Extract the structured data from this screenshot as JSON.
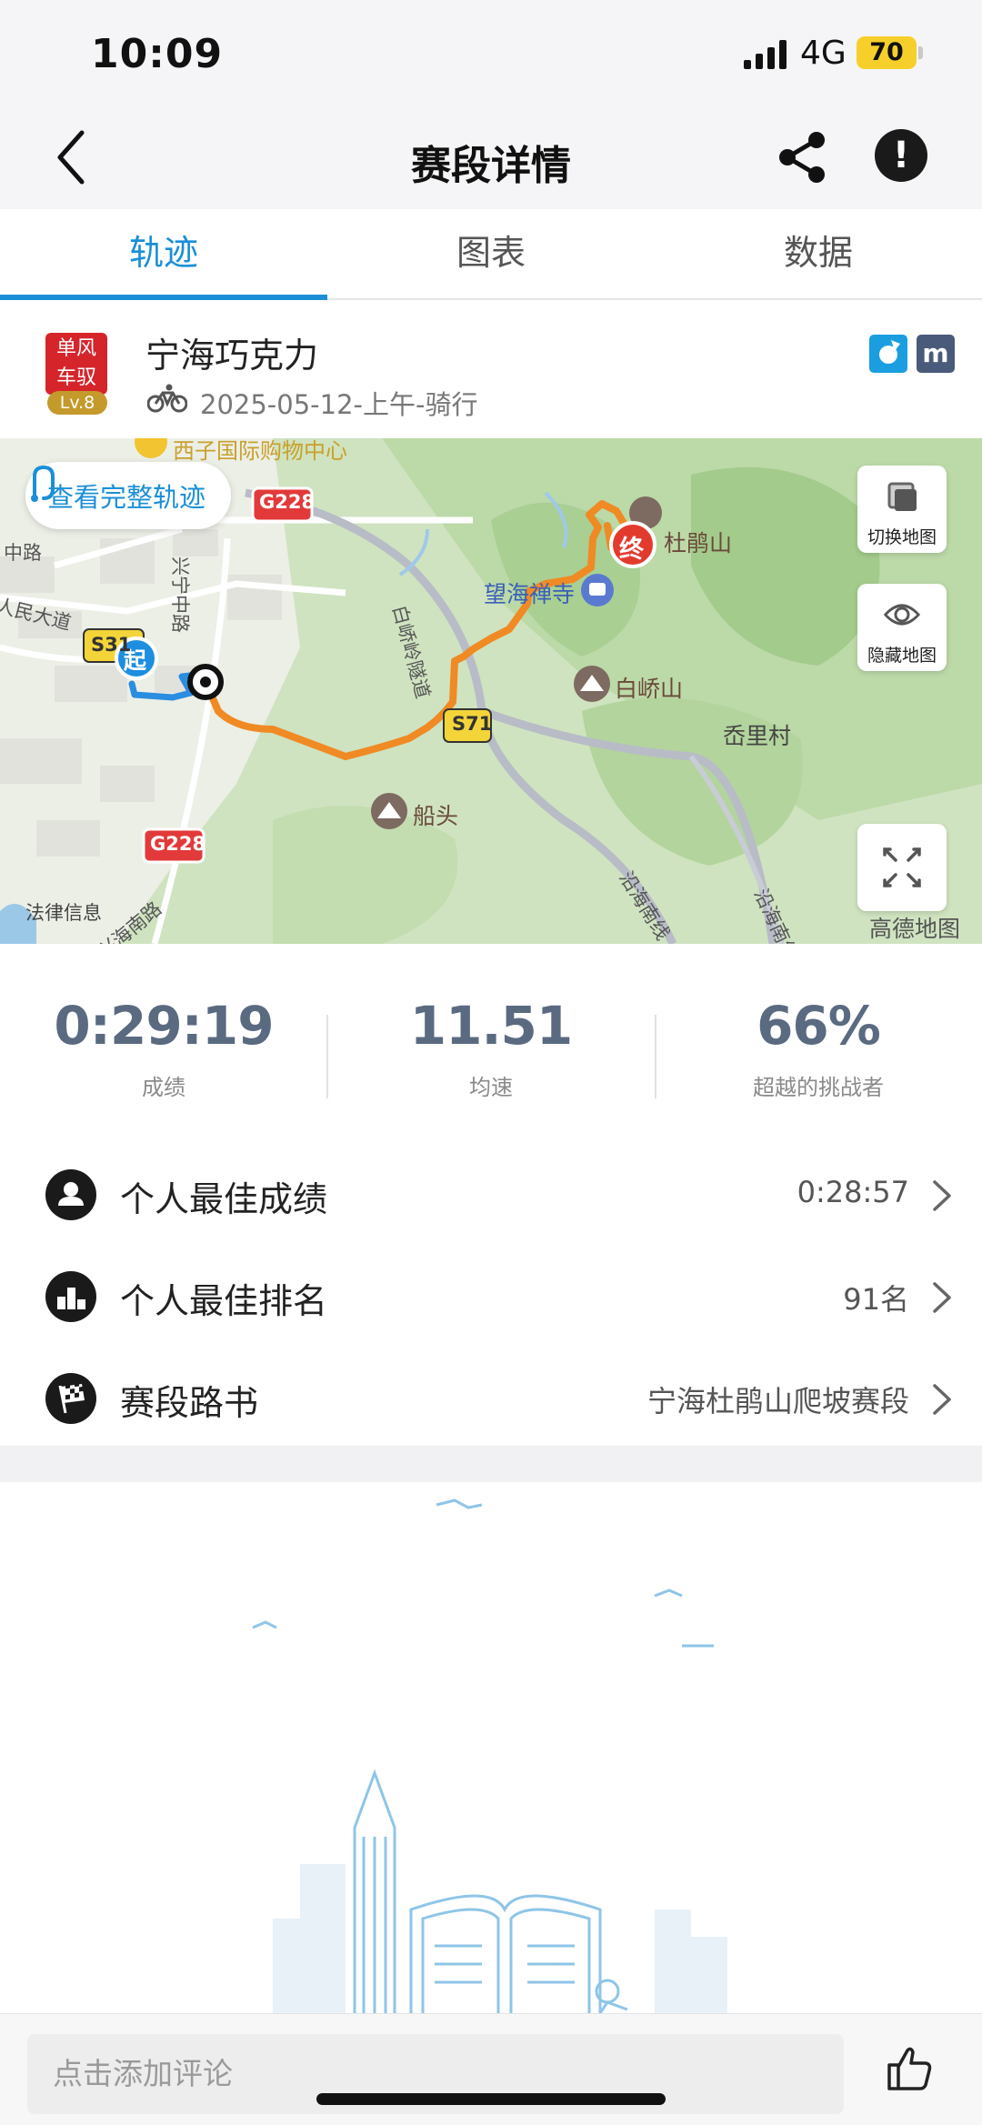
{
  "status_bar": {
    "time": "10:09",
    "network": "4G",
    "battery": "70"
  },
  "nav": {
    "title": "赛段详情"
  },
  "tabs": [
    {
      "label": "轨迹",
      "active": true
    },
    {
      "label": "图表",
      "active": false
    },
    {
      "label": "数据",
      "active": false
    }
  ],
  "segment": {
    "team_logo_text": "单风车驭",
    "level": "Lv.8",
    "name": "宁海巧克力",
    "meta": "2025-05-12-上午-骑行",
    "badge_m": "m"
  },
  "map": {
    "view_full_track": "查看完整轨迹",
    "switch_map": "切换地图",
    "hide_map": "隐藏地图",
    "legal": "法律信息",
    "brand": "高德地图",
    "start_marker": "起",
    "end_marker": "终",
    "labels": {
      "mall": "西子国际购物中心",
      "g228_top": "G228",
      "zhonglu": "中路",
      "renmin": "人民大道",
      "s31": "S31",
      "xingning": "兴宁中路",
      "baiqiao_tunnel": "白峤岭隧道",
      "temple": "望海禅寺",
      "dujuanshan": "杜鹃山",
      "baiqiaoshan": "白峤山",
      "s71": "S71",
      "xiangli": "岙里村",
      "chuantou": "船头",
      "g228_bottom": "G228",
      "xinghai": "兴海南路",
      "yanhai1": "沿海南线",
      "yanhai2": "沿海南线"
    }
  },
  "stats": [
    {
      "value": "0:29:19",
      "label": "成绩"
    },
    {
      "value": "11.51",
      "label": "均速"
    },
    {
      "value": "66%",
      "label": "超越的挑战者"
    }
  ],
  "rows": [
    {
      "label": "个人最佳成绩",
      "value": "0:28:57",
      "icon": "person-icon"
    },
    {
      "label": "个人最佳排名",
      "value": "91名",
      "icon": "podium-icon"
    },
    {
      "label": "赛段路书",
      "value": "宁海杜鹃山爬坡赛段",
      "icon": "checkered-flag-icon"
    }
  ],
  "comment": {
    "placeholder": "点击添加评论"
  },
  "colors": {
    "accent": "#1a8fd8",
    "route": "#f08a24",
    "route_start": "#2a8de0",
    "stat_value": "#5a6a80"
  }
}
